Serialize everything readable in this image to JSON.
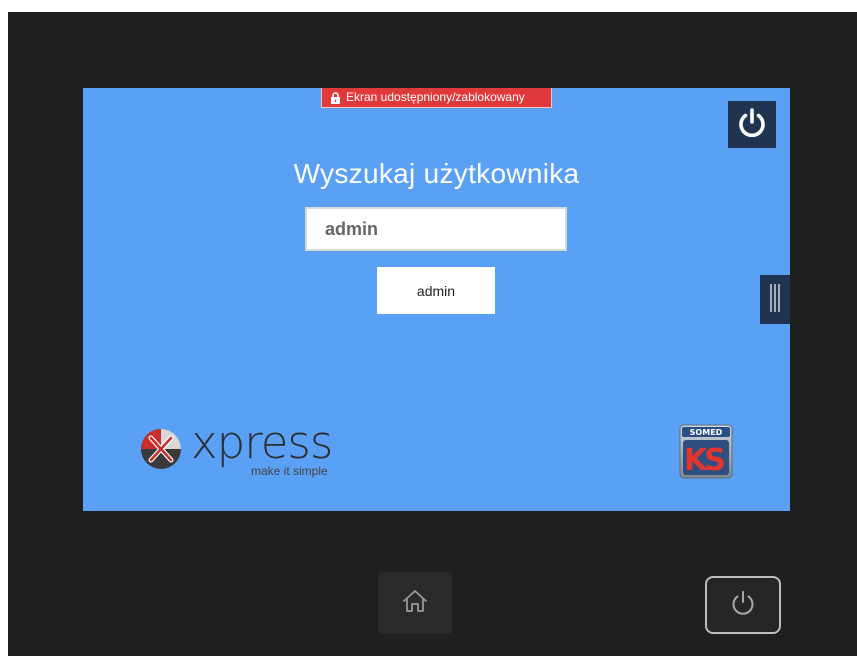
{
  "banner": {
    "text": "Ekran udostępniony/zablokowany",
    "icon": "lock-icon",
    "color": "#e0393b"
  },
  "screen": {
    "background": "#5aa0f5",
    "title": "Wyszukaj użytkownika",
    "search": {
      "value": "admin"
    },
    "result_button_label": "admin",
    "power_icon": "power-icon",
    "side_handle_icon": "drag-handle-icon"
  },
  "logos": {
    "xpress": {
      "word": "xpress",
      "tagline": "make it simple"
    },
    "somed": {
      "text": "SOMED",
      "mark": "KS"
    }
  },
  "hardware": {
    "home_icon": "home-icon",
    "power_icon": "power-icon"
  }
}
